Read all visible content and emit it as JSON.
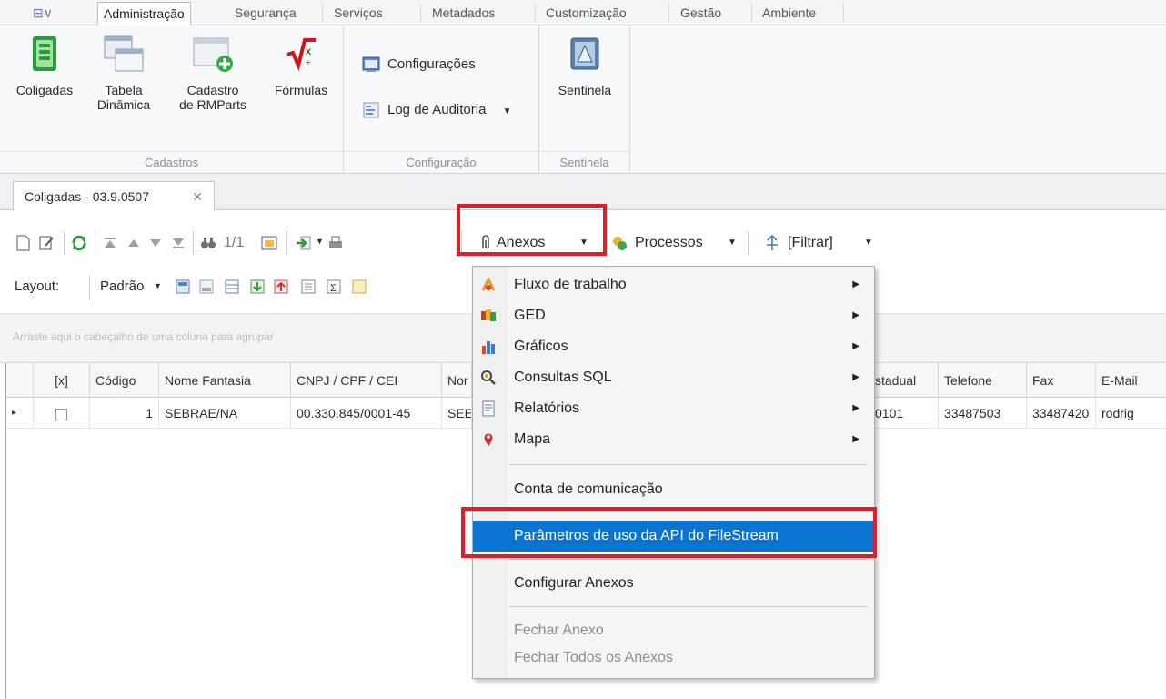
{
  "ribbon": {
    "app_tab": "⊟∨",
    "tabs": [
      "Administração",
      "Segurança",
      "Serviços",
      "Metadados",
      "Customização",
      "Gestão",
      "Ambiente"
    ],
    "active_tab": "Administração",
    "groups": {
      "cadastros": {
        "label": "Cadastros",
        "buttons": [
          {
            "l1": "Coligadas",
            "l2": ""
          },
          {
            "l1": "Tabela",
            "l2": "Dinâmica"
          },
          {
            "l1": "Cadastro",
            "l2": "de RMParts"
          },
          {
            "l1": "Fórmulas",
            "l2": ""
          }
        ]
      },
      "configuracao": {
        "label": "Configuração",
        "buttons": [
          "Configurações",
          "Log de Auditoria"
        ]
      },
      "sentinela": {
        "label": "Sentinela",
        "button": "Sentinela"
      }
    }
  },
  "doc_tab": {
    "label": "Coligadas - 03.9.0507",
    "close": "✕"
  },
  "toolbar": {
    "record_counter": "1/1",
    "anexos_label": "Anexos",
    "processos_label": "Processos",
    "filtrar_label": "[Filtrar]",
    "layout_label": "Layout:",
    "layout_value": "Padrão"
  },
  "group_hint": "Arraste aqui o cabeçalho de uma coluna para agrupar",
  "grid": {
    "columns": [
      "[x]",
      "Código",
      "Nome Fantasia",
      "CNPJ / CPF / CEI",
      "Nor",
      "stadual",
      "Telefone",
      "Fax",
      "E-Mail"
    ],
    "rows": [
      {
        "indicator": "▸",
        "codigo": "1",
        "nome_fantasia": "SEBRAE/NA",
        "cnpj": "00.330.845/0001-45",
        "nome": "SEE",
        "estadual": "0101",
        "telefone": "33487503",
        "fax": "33487420",
        "email": "rodrig"
      }
    ]
  },
  "menu": {
    "items": [
      {
        "label": "Fluxo de trabalho",
        "icon": "workflow-icon",
        "submenu": true
      },
      {
        "label": "GED",
        "icon": "ged-icon",
        "submenu": true
      },
      {
        "label": "Gráficos",
        "icon": "chart-icon",
        "submenu": true
      },
      {
        "label": "Consultas SQL",
        "icon": "sql-query-icon",
        "submenu": true
      },
      {
        "label": "Relatórios",
        "icon": "report-icon",
        "submenu": true
      },
      {
        "label": "Mapa",
        "icon": "map-pin-icon",
        "submenu": true
      },
      {
        "label": "Conta de comunicação"
      },
      {
        "label": "Parâmetros de uso da API do FileStream"
      },
      {
        "label": "Configurar Anexos"
      },
      {
        "label": "Fechar Anexo"
      },
      {
        "label": "Fechar Todos os Anexos"
      }
    ]
  },
  "colors": {
    "highlight": "#e21d2a",
    "menu_selected": "#0a74d1"
  }
}
